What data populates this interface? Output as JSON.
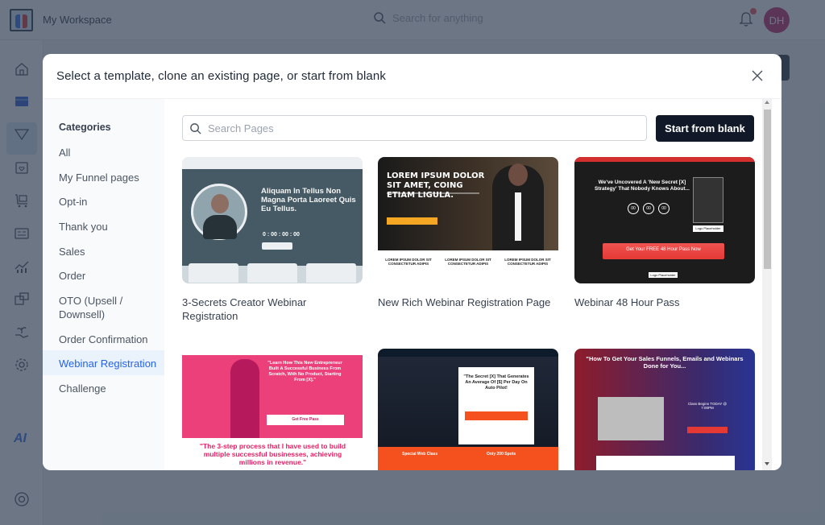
{
  "app": {
    "workspace_name": "My Workspace",
    "search_placeholder": "Search for anything",
    "avatar_initials": "DH",
    "nav_icons": [
      "home-icon",
      "dashboard-icon",
      "funnel-icon",
      "calendar-heart-icon",
      "cart-icon",
      "contact-card-icon",
      "analytics-icon",
      "products-icon",
      "growth-icon",
      "settings-icon",
      "ai-icon",
      "help-icon"
    ],
    "ai_label": "AI"
  },
  "modal": {
    "title": "Select a template, clone an existing page, or start from blank",
    "search_placeholder": "Search Pages",
    "search_value": "",
    "start_blank_label": "Start from blank",
    "categories_heading": "Categories",
    "categories": [
      {
        "label": "All",
        "active": false
      },
      {
        "label": "My Funnel pages",
        "active": false
      },
      {
        "label": "Opt-in",
        "active": false
      },
      {
        "label": "Thank you",
        "active": false
      },
      {
        "label": "Sales",
        "active": false
      },
      {
        "label": "Order",
        "active": false
      },
      {
        "label": "OTO (Upsell / Downsell)",
        "active": false
      },
      {
        "label": "Order Confirmation",
        "active": false
      },
      {
        "label": "Webinar Registration",
        "active": true
      },
      {
        "label": "Challenge",
        "active": false
      }
    ],
    "templates": [
      {
        "title": "3-Secrets Creator Webinar Registration",
        "preview_headline": "Aliquam In Tellus Non Magna Porta Laoreet Quis Eu Tellus.",
        "preview_countdown": "0 : 00 : 00 : 00"
      },
      {
        "title": "New Rich Webinar Registration Page",
        "preview_headline": "LOREM IPSUM DOLOR SIT AMET, COING ETIAM LIGULA.",
        "preview_feature": "LOREM IPSUM DOLOR SIT CONSECTETUR ADIPIS"
      },
      {
        "title": "Webinar 48 Hour Pass",
        "preview_headline": "We've Uncovered A 'New Secret [X] Strategy' That Nobody Knows About...",
        "preview_cta": "Get Your FREE 48 Hour Pass Now",
        "preview_logo": "Logo Placeholder",
        "preview_countdown": [
          "00",
          "00",
          "00"
        ]
      },
      {
        "title": "",
        "preview_headline": "\"Learn How This New Entrepreneur Built A Successful Business From Scratch, With No Product, Starting From [X].\"",
        "preview_cta": "Get Free Pass",
        "preview_quote": "\"The 3-step process that I have used to build multiple successful businesses, achieving millions in revenue.\""
      },
      {
        "title": "",
        "preview_headline": "\"The Secret [X] That Generates An Average Of [$] Per Day On Auto Pilot!",
        "preview_feature_1": "Special Web Class",
        "preview_feature_2": "Only 200 Spots"
      },
      {
        "title": "",
        "preview_headline": "\"How To Get Your Sales Funnels, Emails and Webinars Done for You...",
        "preview_class": "Class Begins TODAY @ 7:00PM"
      }
    ]
  }
}
